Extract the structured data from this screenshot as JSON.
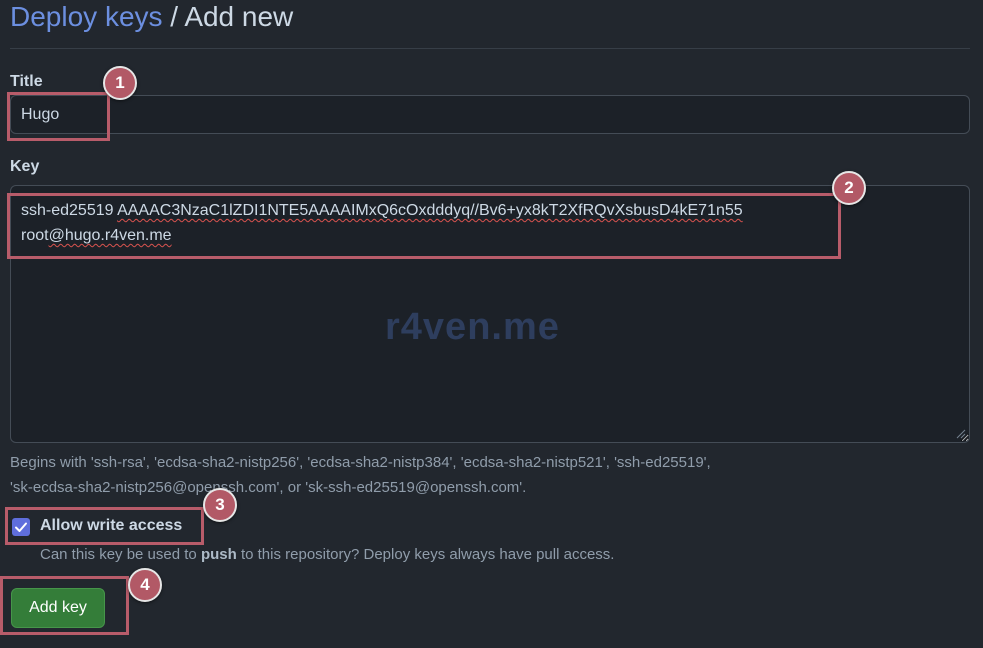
{
  "breadcrumb": {
    "link": "Deploy keys",
    "separator": " / ",
    "current": "Add new"
  },
  "form": {
    "title_label": "Title",
    "title_value": "Hugo",
    "key_label": "Key",
    "key_value": "ssh-ed25519 AAAAC3NzaC1lZDI1NTE5AAAAIMxQ6cOxdddyq//Bv6+yx8kT2XfRQvXsbusD4kE71n55 root@hugo.r4ven.me",
    "key_line1_prefix": "ssh-ed25519 ",
    "key_line1_word": "AAAAC3NzaC1lZDI1NTE5AAAAIMxQ6cOxdddyq//Bv6+yx8kT2XfRQvXsbusD4kE71n55",
    "key_line2_prefix": "root",
    "key_line2_word": "@hugo.r4ven.me",
    "watermark": "r4ven.me",
    "hint_line1": "Begins with 'ssh-rsa', 'ecdsa-sha2-nistp256', 'ecdsa-sha2-nistp384', 'ecdsa-sha2-nistp521', 'ssh-ed25519',",
    "hint_line2": "'sk-ecdsa-sha2-nistp256@openssh.com', or 'sk-ssh-ed25519@openssh.com'.",
    "write_access_label": "Allow write access",
    "write_access_checked": true,
    "write_note_before": "Can this key be used to ",
    "write_note_bold": "push",
    "write_note_after": " to this repository? Deploy keys always have pull access.",
    "submit_label": "Add key"
  },
  "annotations": {
    "badge1": "1",
    "badge2": "2",
    "badge3": "3",
    "badge4": "4",
    "highlight_color": "#b85c6a",
    "badge_color": "#b25966"
  },
  "colors": {
    "background": "#22272e",
    "link": "#6c8fe0",
    "button": "#347d39",
    "checkbox": "#5f6edc"
  },
  "icons": {
    "checkbox": "checkmark-icon",
    "resize": "resize-grip-icon"
  }
}
